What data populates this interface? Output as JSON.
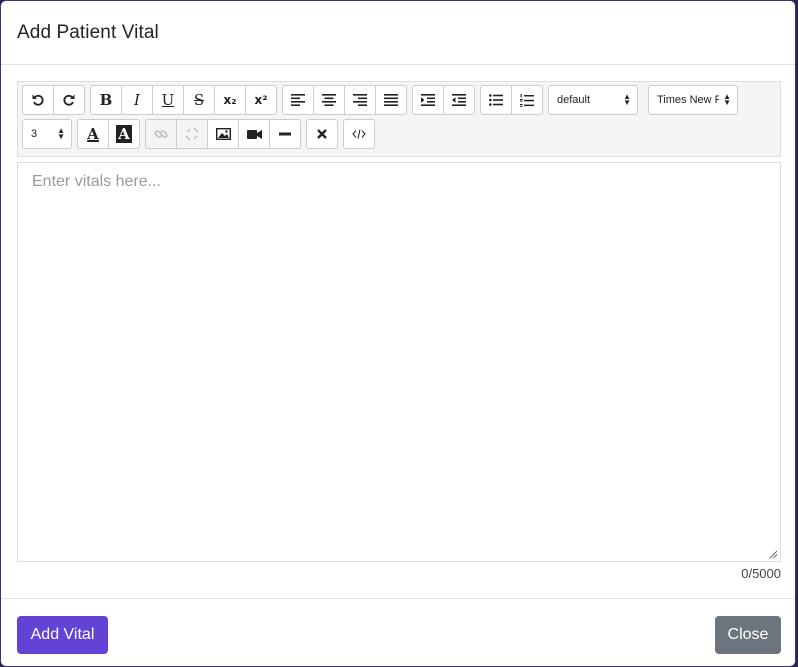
{
  "modal": {
    "title": "Add Patient Vital"
  },
  "toolbar": {
    "history": [
      "undo-icon",
      "redo-icon"
    ],
    "style": {
      "bold": "B",
      "italic": "I",
      "underline": "U",
      "strike": "S",
      "subscript": "x₂",
      "superscript": "x²"
    },
    "align": [
      "align-left-icon",
      "align-center-icon",
      "align-right-icon",
      "align-justify-icon"
    ],
    "indent": [
      "indent-icon",
      "outdent-icon"
    ],
    "lists": [
      "bullet-list-icon",
      "numbered-list-icon"
    ],
    "heading_select": "default",
    "font_select": "Times New R",
    "size_select": "3",
    "color_text": "A",
    "highlight_text": "A",
    "insert": [
      "link-icon",
      "unlink-icon",
      "image-icon",
      "video-icon",
      "horizontal-rule-icon"
    ],
    "clear": "clear-format-icon",
    "code": "code-view-icon"
  },
  "editor": {
    "placeholder": "Enter vitals here...",
    "value": "",
    "counter": "0/5000"
  },
  "footer": {
    "add_label": "Add Vital",
    "close_label": "Close"
  },
  "colors": {
    "primary": "#6342d6",
    "secondary": "#6c757d"
  }
}
